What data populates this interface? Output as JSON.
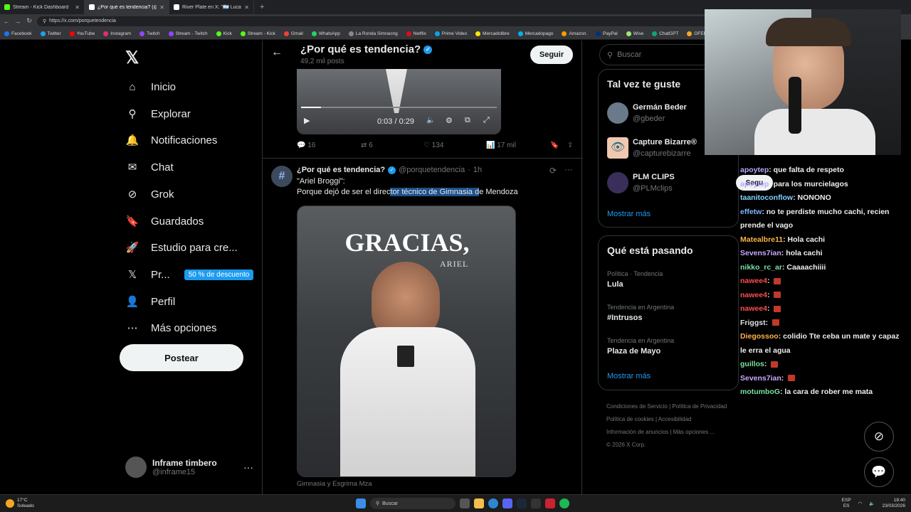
{
  "browser": {
    "tabs": [
      {
        "label": "Stream - Kick Dashboard",
        "color": "#53fc18"
      },
      {
        "label": "¿Por qué es tendencia? (@porque",
        "color": "#ffffff"
      },
      {
        "label": "River Plate en X: \"🇦🇷 Lucas Marti",
        "color": "#ffffff"
      }
    ],
    "url": "https://x.com/porquetendencia",
    "bookmarks": [
      "Facebook",
      "Twitter",
      "YouTube",
      "Instagram",
      "Twitch",
      "Stream - Twitch",
      "Kick",
      "Stream - Kick",
      "Gmail",
      "WhatsApp",
      "La Ronda Simracing",
      "Netflix",
      "Prime Video",
      "Mercadolibre",
      "Mercadopago",
      "Amazon.",
      "PayPal",
      "Wise",
      "ChatGPT",
      "OFERTAS RIKY"
    ]
  },
  "sidebar": {
    "items": [
      {
        "label": "Inicio",
        "icon": "home-icon"
      },
      {
        "label": "Explorar",
        "icon": "search-icon"
      },
      {
        "label": "Notificaciones",
        "icon": "bell-icon"
      },
      {
        "label": "Chat",
        "icon": "mail-icon"
      },
      {
        "label": "Grok",
        "icon": "grok-icon"
      },
      {
        "label": "Guardados",
        "icon": "bookmark-icon"
      },
      {
        "label": "Estudio para cre...",
        "icon": "rocket-icon"
      },
      {
        "label": "Pr...",
        "icon": "x-premium-icon"
      },
      {
        "label": "Perfil",
        "icon": "person-icon"
      },
      {
        "label": "Más opciones",
        "icon": "more-icon"
      }
    ],
    "premium_badge": "50 % de descuento",
    "post_label": "Postear",
    "account_name": "Inframe timbero",
    "account_handle": "@inframe15"
  },
  "header": {
    "title": "¿Por qué es tendencia?",
    "posts": "49,2 mil posts",
    "follow": "Seguir"
  },
  "video": {
    "time": "0:03 / 0:29"
  },
  "actions1": {
    "replies": "16",
    "reposts": "6",
    "likes": "134",
    "views": "17 mil"
  },
  "tweet": {
    "name": "¿Por qué es tendencia?",
    "handle": "@porquetendencia",
    "time": "1h",
    "line1": "\"Ariel Broggi\":",
    "line2_a": "Porque dejó de ser el direc",
    "line2_b": "tor técnico de Gimnasia d",
    "line2_c": "e Mendoza",
    "image_title": "GRACIAS,",
    "image_sub": "ARIEL",
    "caption": "Gimnasia y Esgrima Mza"
  },
  "right": {
    "search": "Buscar",
    "suggest_title": "Tal vez te guste",
    "suggestions": [
      {
        "name": "Germán Beder",
        "handle": "@gbeder"
      },
      {
        "name": "Capture Bizarre®",
        "handle": "@capturebizarre"
      },
      {
        "name": "PLM CLIPS",
        "handle": "@PLMclips"
      }
    ],
    "show_more": "Mostrar más",
    "trends_title": "Qué está pasando",
    "trends": [
      {
        "context": "Política · Tendencia",
        "name": "Lula"
      },
      {
        "context": "Tendencia en Argentina",
        "name": "#Intrusos"
      },
      {
        "context": "Tendencia en Argentina",
        "name": "Plaza de Mayo"
      }
    ],
    "show_more2": "Mostrar más",
    "footer": [
      "Condiciones de Servicio",
      "Política de Privacidad",
      "Política de cookies",
      "Accesibilidad",
      "Información de anuncios",
      "Más opciones ...",
      "© 2026 X Corp."
    ],
    "follow_partial": "Segu"
  },
  "chat": [
    {
      "user": "apoytep",
      "color": "#b9a7ff",
      "msg": ": que falta de respeto"
    },
    {
      "user": "apoytep",
      "color": "#b9a7ff",
      "msg": ": para los murcielagos"
    },
    {
      "user": "taanitoconflow",
      "color": "#7fd4ff",
      "msg": ": NONONO"
    },
    {
      "user": "effetw",
      "color": "#7fb6ff",
      "msg": ": no te perdiste mucho cachi, recien prende el vago"
    },
    {
      "user": "Matealbre11",
      "color": "#ffb347",
      "msg": ": Hola cachi"
    },
    {
      "user": "Sevens7ian",
      "color": "#c9a7ff",
      "msg": ": hola cachi"
    },
    {
      "user": "nikko_rc_ar",
      "color": "#7be0a0",
      "msg": ": Caaaachiiii"
    },
    {
      "user": "nawee4",
      "color": "#ff4d4d",
      "msg": ": "
    },
    {
      "user": "nawee4",
      "color": "#ff4d4d",
      "msg": ": "
    },
    {
      "user": "nawee4",
      "color": "#ff4d4d",
      "msg": ": "
    },
    {
      "user": "Friggst",
      "color": "#e0e0e0",
      "msg": ": "
    },
    {
      "user": "Diegossoo",
      "color": "#ffb347",
      "msg": ": colidio Tte ceba un mate y capaz le erra el agua"
    },
    {
      "user": "guillos",
      "color": "#7be0a0",
      "msg": ": "
    },
    {
      "user": "Sevens7ian",
      "color": "#c9a7ff",
      "msg": ": "
    },
    {
      "user": "motumboG",
      "color": "#7be0a0",
      "msg": ": la cara de rober me mata"
    }
  ],
  "taskbar": {
    "weather_temp": "17°C",
    "weather_text": "Soleado",
    "search": "Buscar",
    "lang1": "ESP",
    "lang2": "ES",
    "time": "18:40",
    "date": "23/03/2026"
  },
  "colors": {
    "accent": "#1d9bf0",
    "border": "#2f3336",
    "muted": "#71767b",
    "highlight": "#1d4f8a"
  }
}
